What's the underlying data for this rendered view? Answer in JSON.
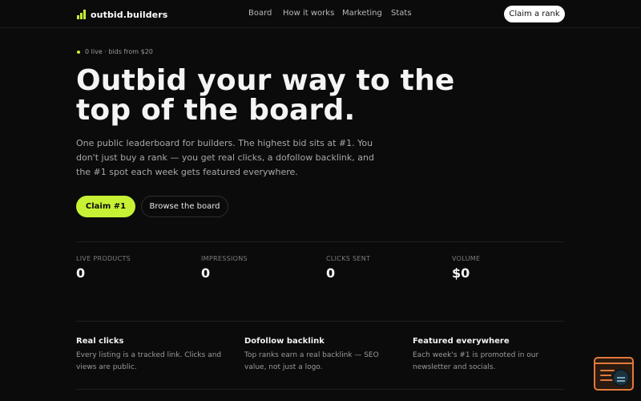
{
  "header": {
    "brand": "outbid.builders",
    "nav": [
      "Board",
      "How it works",
      "Marketing",
      "Stats"
    ],
    "cta": "Claim a rank"
  },
  "hero": {
    "status": "0 live · bids from $20",
    "title": "Outbid your way to the top of the board.",
    "description": "One public leaderboard for builders. The highest bid sits at #1. You don't just buy a rank — you get real clicks, a dofollow backlink, and the #1 spot each week gets featured everywhere.",
    "primary_cta": "Claim #1",
    "secondary_cta": "Browse the board"
  },
  "stats": [
    {
      "label": "LIVE PRODUCTS",
      "value": "0"
    },
    {
      "label": "IMPRESSIONS",
      "value": "0"
    },
    {
      "label": "CLICKS SENT",
      "value": "0"
    },
    {
      "label": "VOLUME",
      "value": "$0"
    }
  ],
  "features": [
    {
      "title": "Real clicks",
      "description": "Every listing is a tracked link. Clicks and views are public."
    },
    {
      "title": "Dofollow backlink",
      "description": "Top ranks earn a real backlink — SEO value, not just a logo."
    },
    {
      "title": "Featured everywhere",
      "description": "Each week's #1 is promoted in our newsletter and socials."
    }
  ],
  "colors": {
    "accent": "#c6f135",
    "background": "#0b0b0b",
    "widget_accent": "#e07a3c"
  }
}
